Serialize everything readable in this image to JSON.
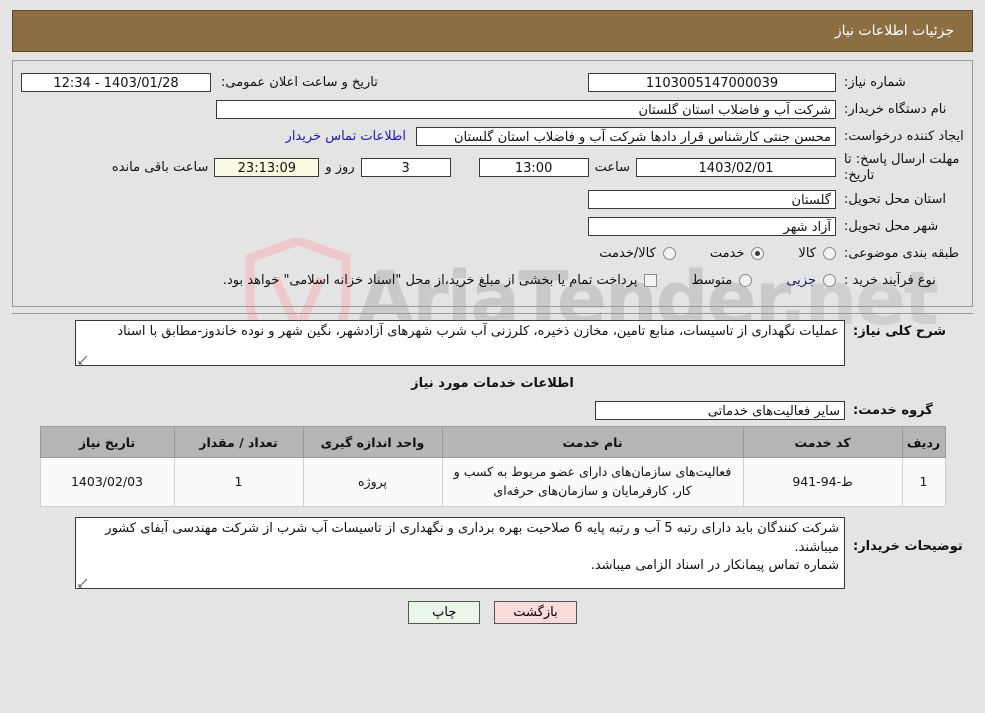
{
  "window": {
    "header_title": "جزئیات اطلاعات نیاز",
    "header_color": "#8d6e42"
  },
  "watermark": {
    "text": "AriaTender",
    "suffix": ".net",
    "color": "#c9c9c9"
  },
  "summary": {
    "need_number_label": "شماره نیاز:",
    "need_number_value": "1103005147000039",
    "public_announce_label": "تاریخ و ساعت اعلان عمومی:",
    "public_announce_value": "1403/01/28 - 12:34",
    "buyer_org_label": "نام دستگاه خریدار:",
    "buyer_org_value": "شرکت آب و فاضلاب استان گلستان",
    "creator_label": "ایجاد کننده درخواست:",
    "creator_value": "محسن جنتی کارشناس قرار دادها شرکت آب و فاضلاب استان گلستان",
    "contact_link": "اطلاعات تماس خریدار",
    "deadline_label": "مهلت ارسال پاسخ: تا تاریخ:",
    "deadline_date": "1403/02/01",
    "hour_label": "ساعت",
    "hour_value": "13:00",
    "days_value": "3",
    "days_unit": "روز و",
    "countdown_value": "23:13:09",
    "countdown_suffix": "ساعت باقی مانده",
    "province_label": "استان محل تحویل:",
    "province_value": "گلستان",
    "city_label": "شهر محل تحویل:",
    "city_value": "آزاد شهر"
  },
  "classification": {
    "label": "طبقه بندی موضوعی:",
    "options": [
      {
        "label": "کالا",
        "selected": false
      },
      {
        "label": "خدمت",
        "selected": true
      },
      {
        "label": "کالا/خدمت",
        "selected": false
      }
    ]
  },
  "purchase_type": {
    "label": "نوع فرآیند خرید :",
    "options": [
      {
        "label": "جزیی",
        "selected": false
      },
      {
        "label": "متوسط",
        "selected": false
      }
    ],
    "treasury_checkbox_checked": false,
    "treasury_note": "پرداخت تمام یا بخشی از مبلغ خرید،از محل \"اسناد خزانه اسلامی\" خواهد بود."
  },
  "description": {
    "label": "شرح کلی نیاز:",
    "value": "عملیات نگهداری از تاسیسات، منابع تامین، مخازن ذخیره، کلرزنی آب شرب شهرهای آزادشهر، نگین شهر و نوده خاندوز-مطابق با اسناد"
  },
  "services_section": {
    "title": "اطلاعات خدمات مورد نیاز",
    "group_label": "گروه خدمت:",
    "group_value": "سایر فعالیت‌های خدماتی"
  },
  "table": {
    "headers": [
      "ردیف",
      "کد خدمت",
      "نام خدمت",
      "واحد اندازه گیری",
      "تعداد / مقدار",
      "تاریخ نیاز"
    ],
    "rows": [
      {
        "index": "1",
        "code": "ط-94-941",
        "name": "فعالیت‌های سازمان‌های دارای عضو مربوط به کسب و کار، کارفرمایان و سازمان‌های حرفه‌ای",
        "unit": "پروژه",
        "quantity": "1",
        "need_date": "1403/02/03"
      }
    ]
  },
  "buyer_notes": {
    "label": "توضیحات خریدار:",
    "value": "شرکت کنندگان باید دارای رتبه 5 آب و رتبه  پایه 6 صلاحیت بهره برداری و نگهداری از تاسیسات آب شرب از شرکت مهندسی آبفای کشور میباشند.\nشماره تماس پیمانکار در اسناد الزامی میباشد."
  },
  "footer": {
    "print_label": "چاپ",
    "back_label": "بازگشت"
  }
}
